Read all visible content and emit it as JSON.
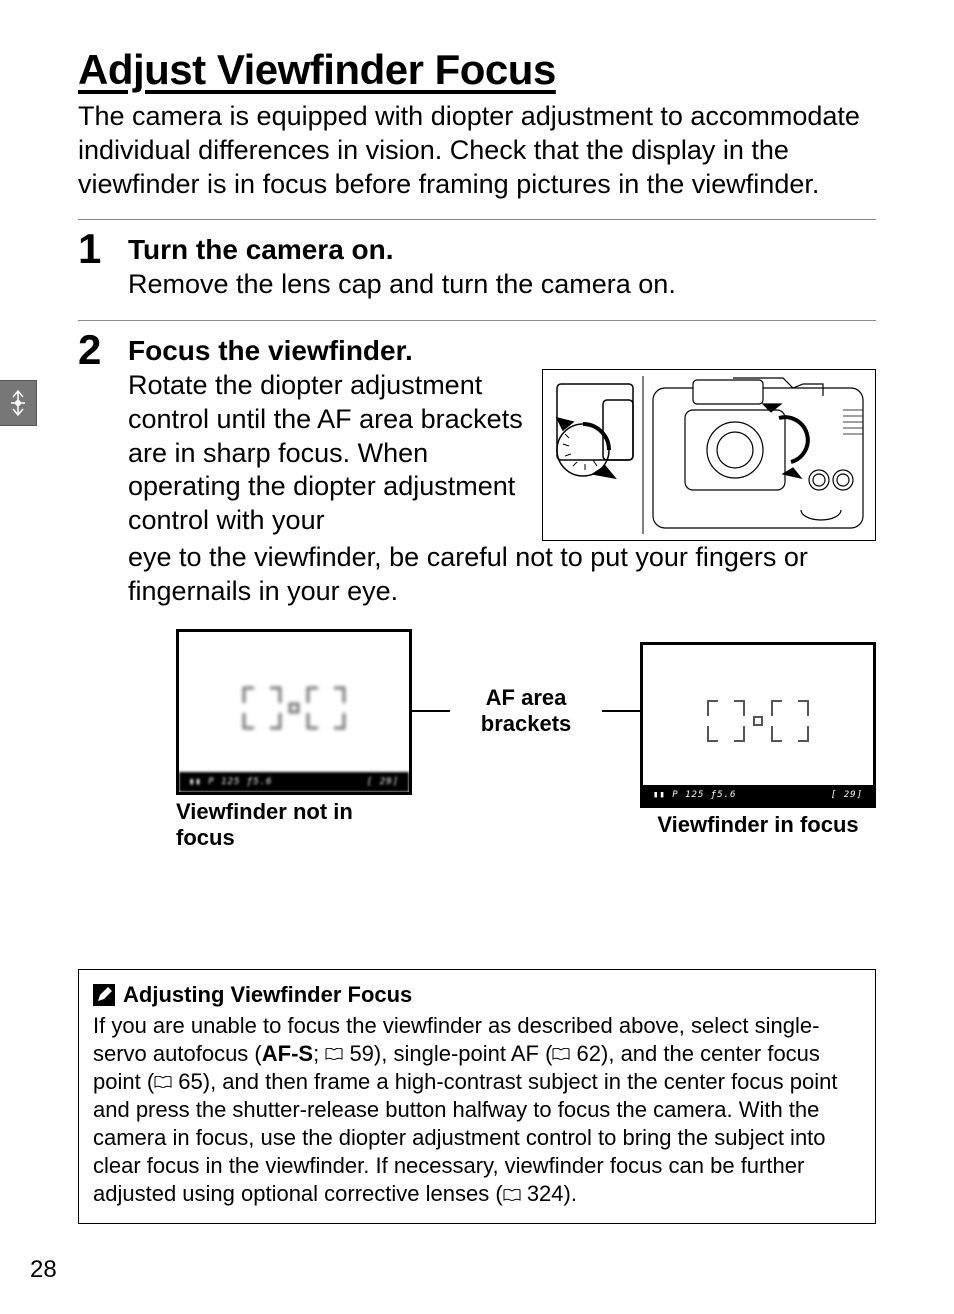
{
  "title": "Adjust Viewfinder Focus",
  "intro": "The camera is equipped with diopter adjustment to accommodate individual differences in vision.  Check that the display in the viewfinder is in focus before framing pictures in the viewfinder.",
  "steps": {
    "s1": {
      "num": "1",
      "title": "Turn the camera on.",
      "text": "Remove the lens cap and turn the camera on."
    },
    "s2": {
      "num": "2",
      "title": "Focus the viewfinder.",
      "text1": "Rotate the diopter adjustment control until the AF area brackets are in sharp focus. When operating the diopter adjustment control with your",
      "text2": "eye to the viewfinder, be careful not to put your fingers or fingernails in your eye."
    }
  },
  "figure": {
    "center_label": "AF area brackets",
    "left_caption": "Viewfinder not in focus",
    "right_caption": "Viewfinder in focus",
    "readout_left": "P  125  ƒ5.6",
    "readout_right": "[ 29]"
  },
  "note": {
    "title": "Adjusting Viewfinder Focus",
    "pre": "If you are unable to focus the viewfinder as described above, select single-servo autofocus (",
    "afs": "AF-S",
    "r1": "59), single-point AF (",
    "r2": "62), and the center focus point (",
    "r3": "65), and then frame a high-contrast subject in the center focus point and press the shutter-release button halfway to focus the camera.  With the camera in focus, use the diopter adjustment control to bring the subject into clear focus in the viewfinder.  If necessary, viewfinder focus can be further adjusted using optional corrective lenses (",
    "r4": "324)."
  },
  "page_number": "28"
}
